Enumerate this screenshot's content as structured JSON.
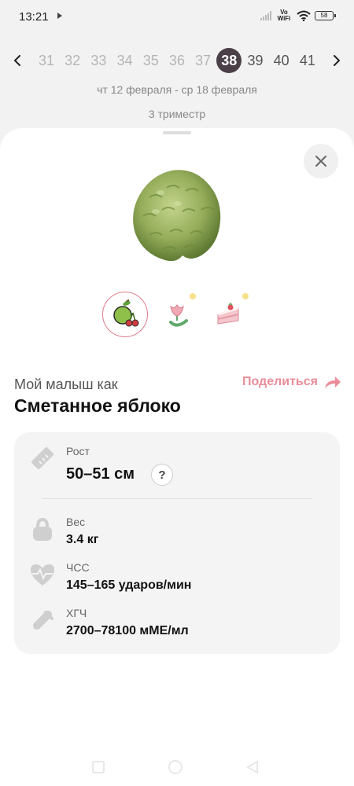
{
  "status_bar": {
    "time": "13:21",
    "network": "Vo WiFi",
    "battery": "58"
  },
  "week_nav": {
    "weeks": [
      {
        "label": "31",
        "state": "far"
      },
      {
        "label": "32",
        "state": "far"
      },
      {
        "label": "33",
        "state": "far"
      },
      {
        "label": "34",
        "state": "far"
      },
      {
        "label": "35",
        "state": "far"
      },
      {
        "label": "36",
        "state": "far"
      },
      {
        "label": "37",
        "state": "far"
      },
      {
        "label": "38",
        "state": "active"
      },
      {
        "label": "39",
        "state": "near"
      },
      {
        "label": "40",
        "state": "near"
      },
      {
        "label": "41",
        "state": "near"
      }
    ],
    "date_range": "чт 12 февраля - ср 18 февраля",
    "trimester": "3 триместр"
  },
  "comparison": {
    "options": [
      {
        "icon": "apple-cherry-icon",
        "selected": true
      },
      {
        "icon": "flower-icon",
        "selected": false
      },
      {
        "icon": "cake-icon",
        "selected": false
      }
    ],
    "caption": "Мой малыш как",
    "share_label": "Поделиться",
    "fruit_name": "Сметанное яблоко"
  },
  "stats": {
    "height": {
      "label": "Рост",
      "value": "50–51 см",
      "help": "?"
    },
    "weight": {
      "label": "Вес",
      "value": "3.4 кг"
    },
    "heart_rate": {
      "label": "ЧСС",
      "value": "145–165 ударов/мин"
    },
    "hcg": {
      "label": "ХГЧ",
      "value": "2700–78100 мМЕ/мл"
    }
  },
  "colors": {
    "accent_pink": "#e98d9a",
    "active_week": "#4b4048",
    "icon_grey": "#cfcfcf"
  }
}
